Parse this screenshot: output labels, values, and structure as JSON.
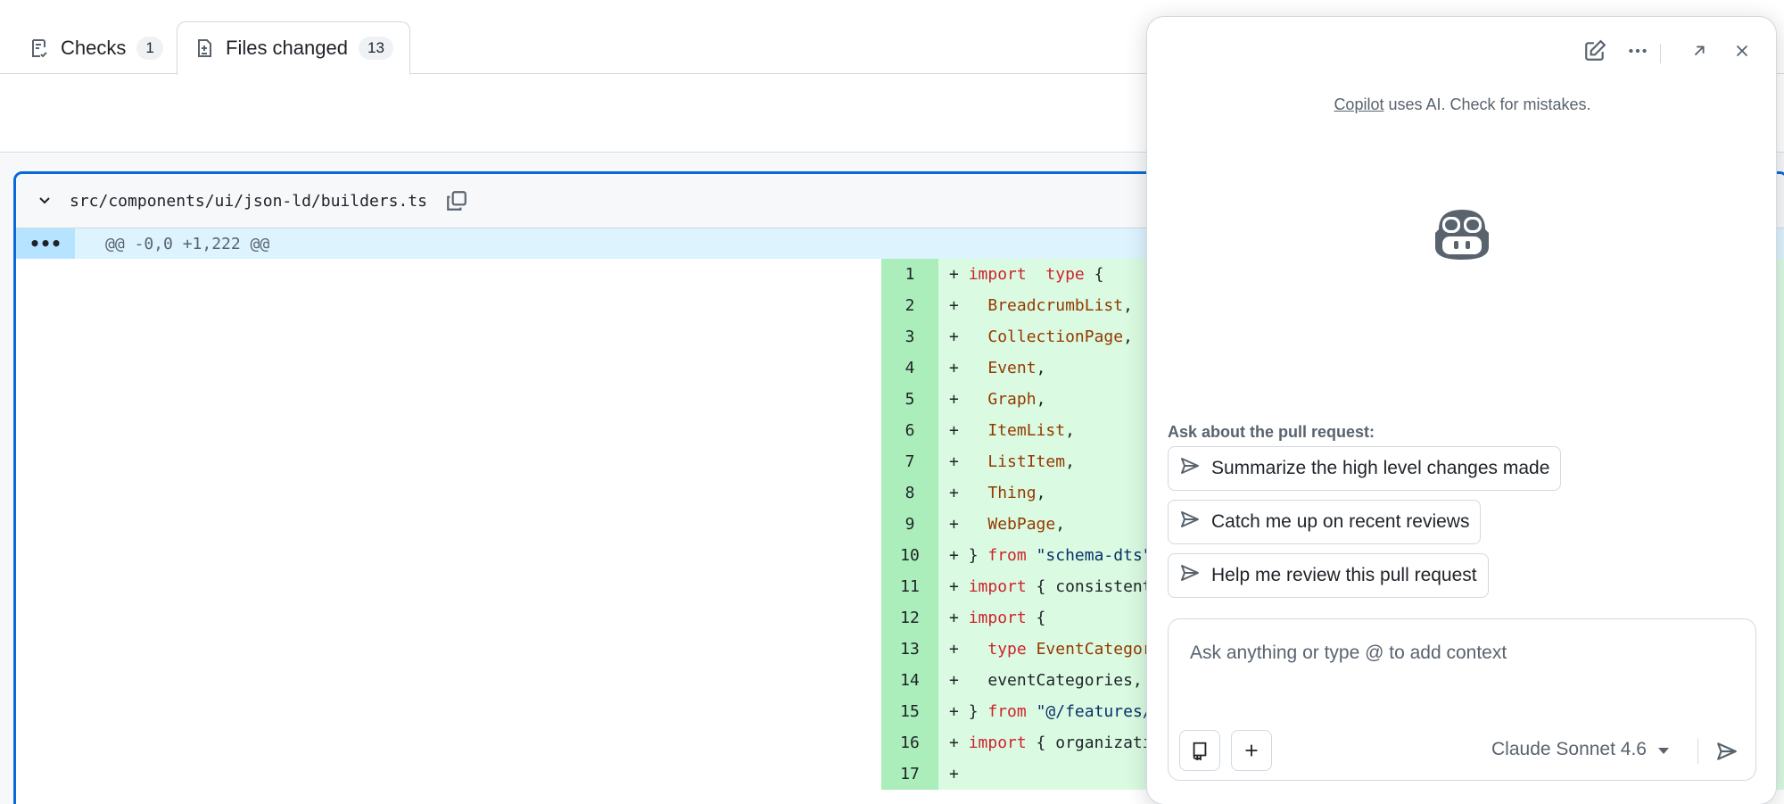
{
  "tabs": [
    {
      "label": "Checks",
      "count": "1",
      "icon": "checklist-icon"
    },
    {
      "label": "Files changed",
      "count": "13",
      "icon": "file-diff-icon"
    }
  ],
  "file": {
    "path": "src/components/ui/json-ld/builders.ts",
    "hunk": "@@ -0,0 +1,222 @@",
    "expand_label": "•••",
    "lines": [
      {
        "num": "1",
        "sign": "+ ",
        "parts": [
          [
            "kw",
            "import"
          ],
          [
            "",
            "  "
          ],
          [
            "kw",
            "type"
          ],
          [
            "",
            " {"
          ]
        ]
      },
      {
        "num": "2",
        "sign": "+ ",
        "parts": [
          [
            "",
            "  "
          ],
          [
            "ty",
            "BreadcrumbList"
          ],
          [
            "",
            ","
          ]
        ]
      },
      {
        "num": "3",
        "sign": "+ ",
        "parts": [
          [
            "",
            "  "
          ],
          [
            "ty",
            "CollectionPage"
          ],
          [
            "",
            ","
          ]
        ]
      },
      {
        "num": "4",
        "sign": "+ ",
        "parts": [
          [
            "",
            "  "
          ],
          [
            "ty",
            "Event"
          ],
          [
            "",
            ","
          ]
        ]
      },
      {
        "num": "5",
        "sign": "+ ",
        "parts": [
          [
            "",
            "  "
          ],
          [
            "ty",
            "Graph"
          ],
          [
            "",
            ","
          ]
        ]
      },
      {
        "num": "6",
        "sign": "+ ",
        "parts": [
          [
            "",
            "  "
          ],
          [
            "ty",
            "ItemList"
          ],
          [
            "",
            ","
          ]
        ]
      },
      {
        "num": "7",
        "sign": "+ ",
        "parts": [
          [
            "",
            "  "
          ],
          [
            "ty",
            "ListItem"
          ],
          [
            "",
            ","
          ]
        ]
      },
      {
        "num": "8",
        "sign": "+ ",
        "parts": [
          [
            "",
            "  "
          ],
          [
            "ty",
            "Thing"
          ],
          [
            "",
            ","
          ]
        ]
      },
      {
        "num": "9",
        "sign": "+ ",
        "parts": [
          [
            "",
            "  "
          ],
          [
            "ty",
            "WebPage"
          ],
          [
            "",
            ","
          ]
        ]
      },
      {
        "num": "10",
        "sign": "+ ",
        "parts": [
          [
            "",
            "} "
          ],
          [
            "kw",
            "from"
          ],
          [
            "str",
            " \"schema-dts\""
          ]
        ]
      },
      {
        "num": "11",
        "sign": "+ ",
        "parts": [
          [
            "kw",
            "import"
          ],
          [
            "",
            " { consistent"
          ]
        ]
      },
      {
        "num": "12",
        "sign": "+ ",
        "parts": [
          [
            "kw",
            "import"
          ],
          [
            "",
            " {"
          ]
        ]
      },
      {
        "num": "13",
        "sign": "+ ",
        "parts": [
          [
            "",
            "  "
          ],
          [
            "kw",
            "type"
          ],
          [
            "ty",
            " EventCategor"
          ]
        ]
      },
      {
        "num": "14",
        "sign": "+ ",
        "parts": [
          [
            "",
            "  eventCategories,"
          ]
        ]
      },
      {
        "num": "15",
        "sign": "+ ",
        "parts": [
          [
            "",
            "} "
          ],
          [
            "kw",
            "from"
          ],
          [
            "str",
            " \"@/features/"
          ]
        ]
      },
      {
        "num": "16",
        "sign": "+ ",
        "parts": [
          [
            "kw",
            "import"
          ],
          [
            "",
            " { organizati"
          ]
        ]
      },
      {
        "num": "17",
        "sign": "+ ",
        "parts": [
          [
            "",
            ""
          ]
        ]
      }
    ]
  },
  "copilot": {
    "disclaimer_link": "Copilot",
    "disclaimer_rest": " uses AI. Check for mistakes.",
    "ask_label": "Ask about the pull request:",
    "suggestions": [
      "Summarize the high level changes made",
      "Catch me up on recent reviews",
      "Help me review this pull request"
    ],
    "placeholder": "Ask anything or type @ to add context",
    "model": "Claude Sonnet 4.6",
    "icons": [
      "new-chat-icon",
      "more-options-icon",
      "expand-icon",
      "close-icon"
    ]
  },
  "colors": {
    "accent": "#0969da",
    "added_num_bg": "#aceebb",
    "added_code_bg": "#dafbe1",
    "hunk_bg": "#ddf4ff"
  }
}
